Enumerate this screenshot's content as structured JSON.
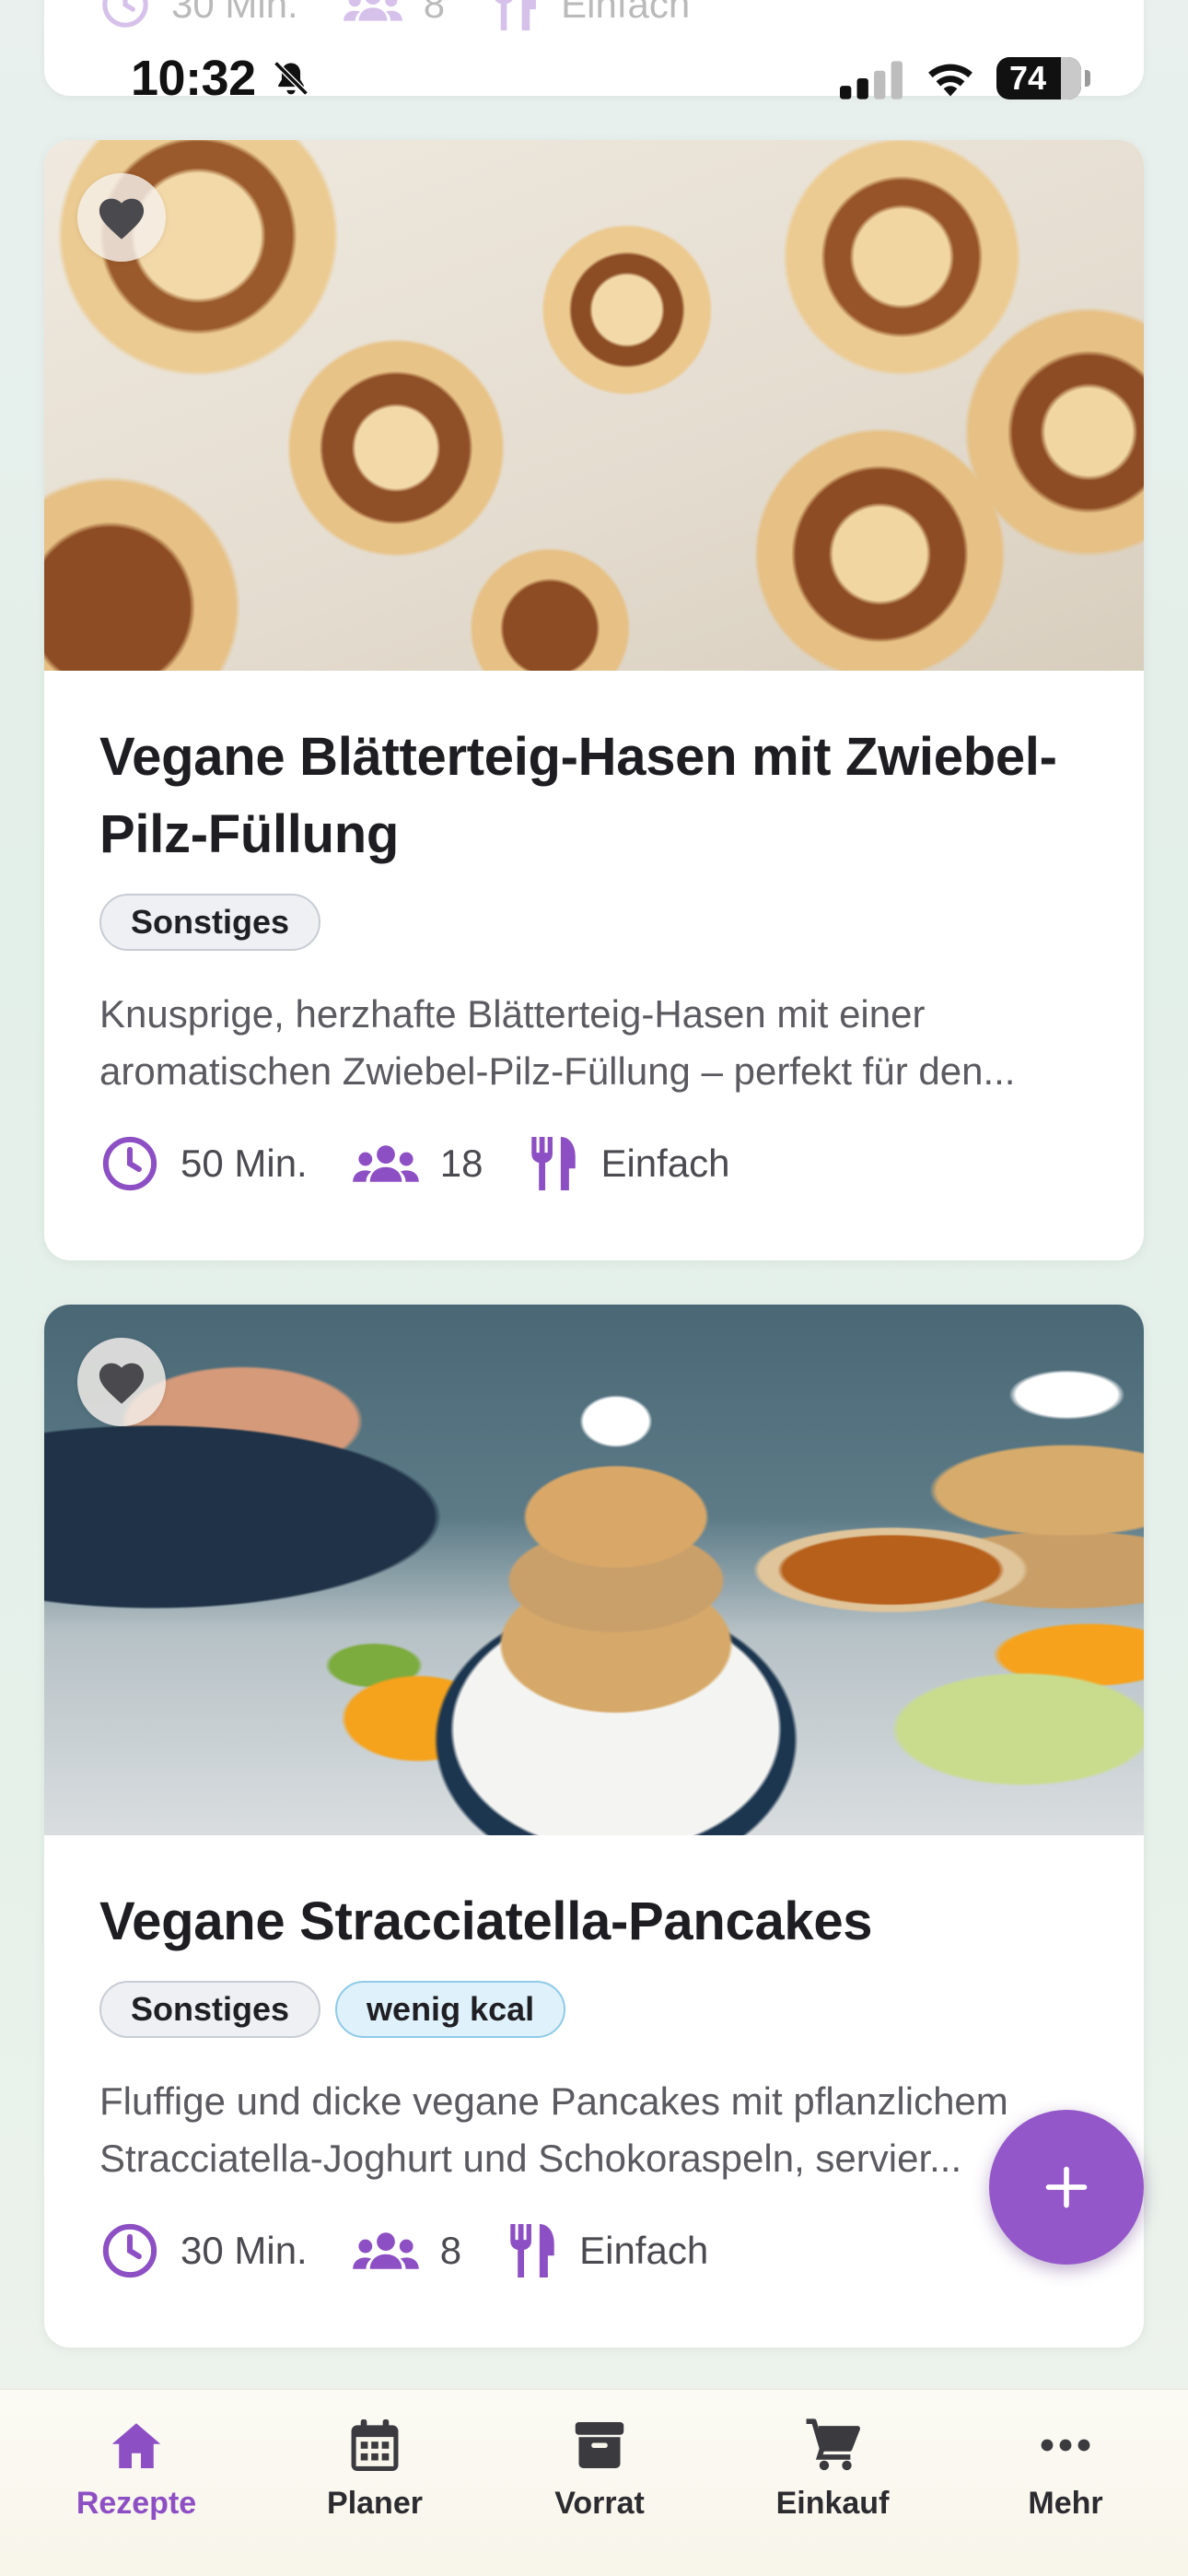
{
  "status_bar": {
    "time": "10:32",
    "battery": "74"
  },
  "previous_card": {
    "time": "30 Min.",
    "servings": "8",
    "difficulty": "Einfach"
  },
  "recipes": [
    {
      "title": "Vegane Blätterteig-Hasen mit Zwiebel-Pilz-Füllung",
      "tags": [
        "Sonstiges"
      ],
      "description": "Knusprige, herzhafte Blätterteig-Hasen mit einer aromatischen Zwiebel-Pilz-Füllung – perfekt für den...",
      "time": "50 Min.",
      "servings": "18",
      "difficulty": "Einfach"
    },
    {
      "title": "Vegane Stracciatella-Pancakes",
      "tags": [
        "Sonstiges",
        "wenig kcal"
      ],
      "description": "Fluffige und dicke vegane Pancakes mit pflanzlichem Stracciatella-Joghurt und Schokoraspeln, servier...",
      "time": "30 Min.",
      "servings": "8",
      "difficulty": "Einfach"
    }
  ],
  "fab": {
    "icon": "plus-icon"
  },
  "nav": [
    {
      "label": "Rezepte",
      "icon": "home-icon",
      "active": true
    },
    {
      "label": "Planer",
      "icon": "calendar-icon",
      "active": false
    },
    {
      "label": "Vorrat",
      "icon": "archive-box-icon",
      "active": false
    },
    {
      "label": "Einkauf",
      "icon": "cart-icon",
      "active": false
    },
    {
      "label": "Mehr",
      "icon": "more-icon",
      "active": false
    }
  ],
  "colors": {
    "accent": "#9457c9",
    "meta_icon": "#8d4fc4",
    "chip_blue_bg": "#dff1fb",
    "chip_grey_bg": "#eef0f4"
  }
}
